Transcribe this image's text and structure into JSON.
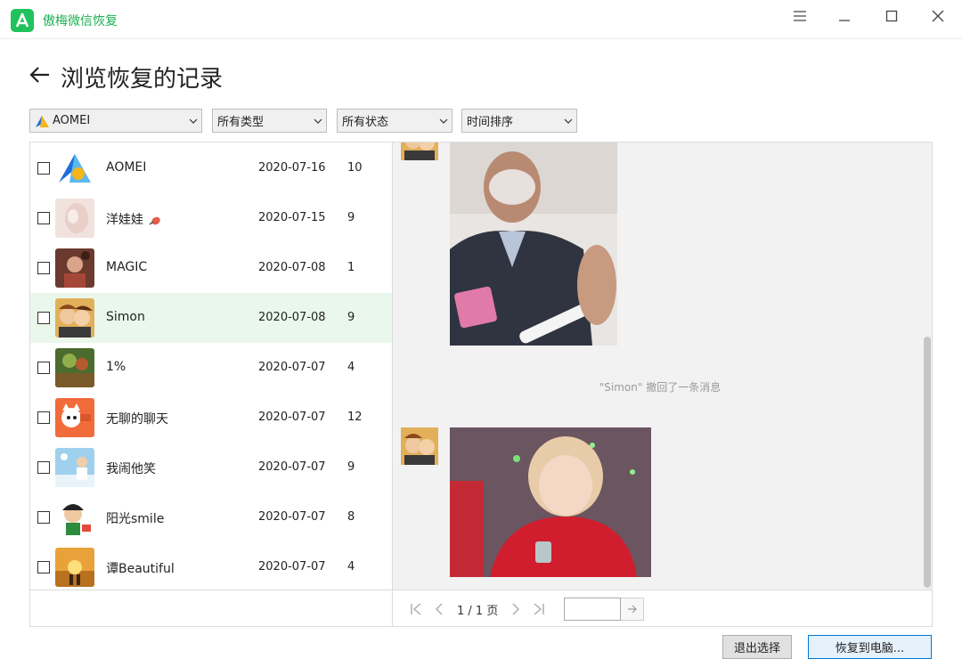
{
  "app": {
    "title": "傲梅微信恢复"
  },
  "window": {
    "menu_icon": "hamburger-icon",
    "minimize_icon": "minimize-icon",
    "maximize_icon": "maximize-icon",
    "close_icon": "close-icon"
  },
  "header": {
    "title": "浏览恢复的记录",
    "back_icon": "arrow-left-icon"
  },
  "filters": {
    "account": {
      "value": "AOMEI"
    },
    "type": {
      "value": "所有类型"
    },
    "status": {
      "value": "所有状态"
    },
    "sort": {
      "value": "时间排序"
    }
  },
  "contacts": [
    {
      "name": "AOMEI",
      "date": "2020-07-16",
      "count": "10",
      "selected": false,
      "checked": false
    },
    {
      "name": "洋娃娃",
      "date": "2020-07-15",
      "count": "9",
      "selected": false,
      "checked": false
    },
    {
      "name": "MAGIC",
      "date": "2020-07-08",
      "count": "1",
      "selected": false,
      "checked": false
    },
    {
      "name": "Simon",
      "date": "2020-07-08",
      "count": "9",
      "selected": true,
      "checked": false
    },
    {
      "name": "1%",
      "date": "2020-07-07",
      "count": "4",
      "selected": false,
      "checked": false
    },
    {
      "name": "无聊的聊天",
      "date": "2020-07-07",
      "count": "12",
      "selected": false,
      "checked": false
    },
    {
      "name": "我闹他笑",
      "date": "2020-07-07",
      "count": "9",
      "selected": false,
      "checked": false
    },
    {
      "name": "阳光smile",
      "date": "2020-07-07",
      "count": "8",
      "selected": false,
      "checked": false
    },
    {
      "name": "谭Beautiful",
      "date": "2020-07-07",
      "count": "4",
      "selected": false,
      "checked": false
    }
  ],
  "chat": {
    "recall_notice": "\"Simon\" 撤回了一条消息"
  },
  "pagination": {
    "indicator": "1 / 1 页",
    "jump_value": ""
  },
  "buttons": {
    "exit_select": "退出选择",
    "restore_pc": "恢复到电脑..."
  },
  "colors": {
    "accent": "#1fc25c",
    "selected_row": "#e9f8ea",
    "primary_border": "#0078d7"
  }
}
